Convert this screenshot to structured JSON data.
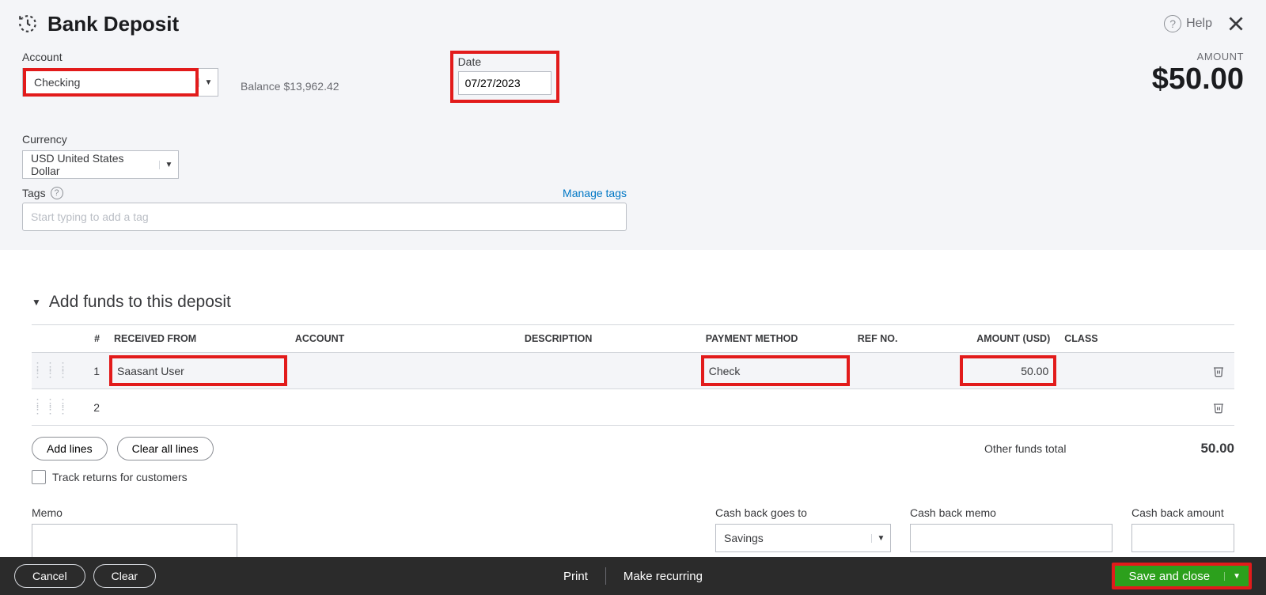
{
  "header": {
    "title": "Bank Deposit",
    "help_label": "Help"
  },
  "account": {
    "label": "Account",
    "value": "Checking",
    "balance_label": "Balance",
    "balance_value": "$13,962.42"
  },
  "date": {
    "label": "Date",
    "value": "07/27/2023"
  },
  "amount": {
    "label": "AMOUNT",
    "value": "$50.00"
  },
  "currency": {
    "label": "Currency",
    "value": "USD United States Dollar"
  },
  "tags": {
    "label": "Tags",
    "placeholder": "Start typing to add a tag",
    "manage_label": "Manage tags"
  },
  "funds": {
    "section_title": "Add funds to this deposit",
    "columns": {
      "num": "#",
      "received_from": "RECEIVED FROM",
      "account": "ACCOUNT",
      "description": "DESCRIPTION",
      "payment_method": "PAYMENT METHOD",
      "ref_no": "REF NO.",
      "amount": "AMOUNT (USD)",
      "class": "CLASS"
    },
    "rows": [
      {
        "num": "1",
        "received_from": "Saasant User",
        "account": "",
        "description": "",
        "payment_method": "Check",
        "ref_no": "",
        "amount": "50.00",
        "class": ""
      },
      {
        "num": "2",
        "received_from": "",
        "account": "",
        "description": "",
        "payment_method": "",
        "ref_no": "",
        "amount": "",
        "class": ""
      }
    ],
    "add_lines_label": "Add lines",
    "clear_all_label": "Clear all lines",
    "other_total_label": "Other funds total",
    "other_total_value": "50.00",
    "track_returns_label": "Track returns for customers"
  },
  "memo": {
    "label": "Memo"
  },
  "cashback": {
    "goes_to_label": "Cash back goes to",
    "goes_to_value": "Savings",
    "memo_label": "Cash back memo",
    "amount_label": "Cash back amount"
  },
  "footer": {
    "cancel": "Cancel",
    "clear": "Clear",
    "print": "Print",
    "recurring": "Make recurring",
    "save": "Save and close"
  }
}
